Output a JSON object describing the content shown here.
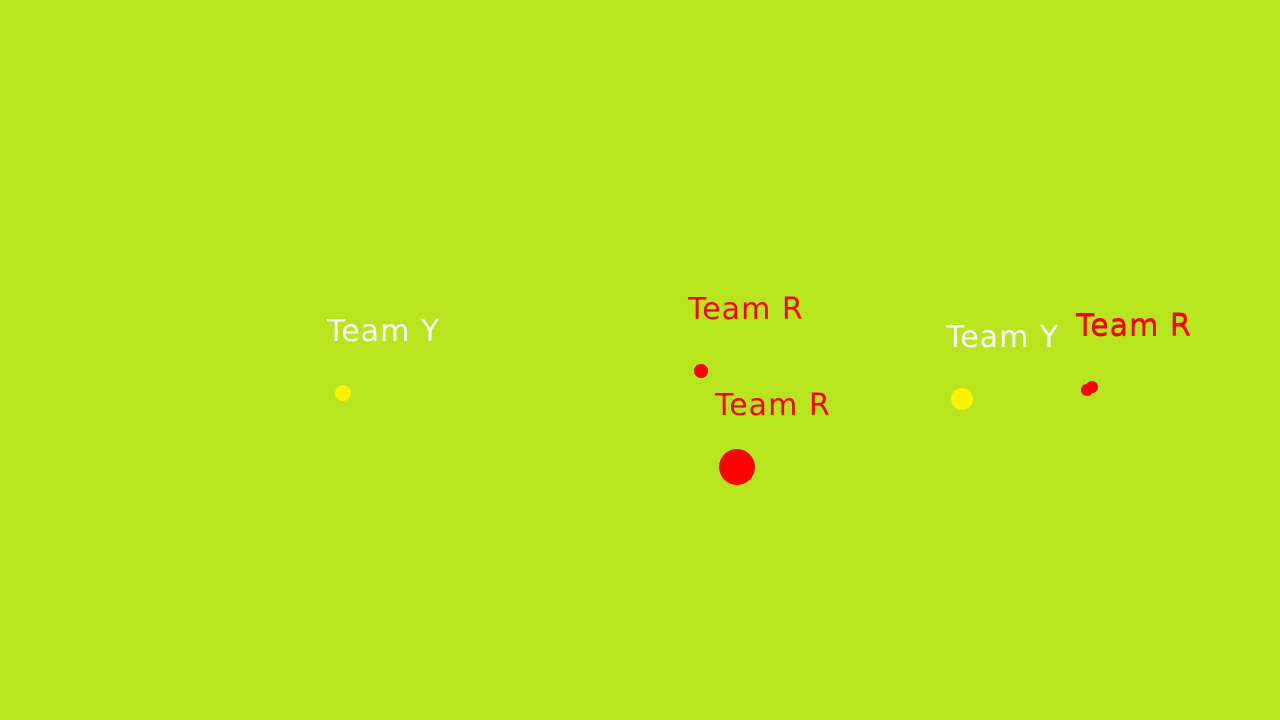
{
  "colors": {
    "field": "#b7e61f",
    "team_y_label": "#ffffff",
    "team_y_marker": "#fff200",
    "team_r_label": "#ff0000",
    "team_r_marker": "#ff0000"
  },
  "players": [
    {
      "team": "y",
      "label": "Team Y"
    },
    {
      "team": "r",
      "label": "Team R"
    },
    {
      "team": "r",
      "label": "Team R"
    },
    {
      "team": "y",
      "label": "Team Y"
    },
    {
      "team": "r",
      "label": "Team R"
    },
    {
      "team": "r",
      "label": "Team R"
    }
  ]
}
